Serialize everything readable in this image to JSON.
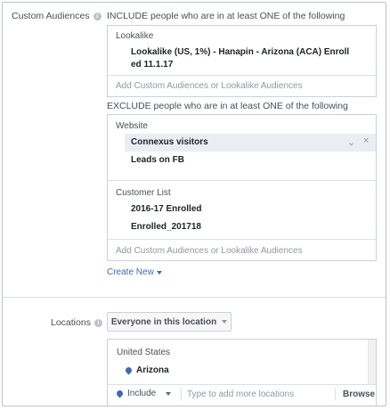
{
  "audiences": {
    "label": "Custom Audiences",
    "include_title": "INCLUDE people who are in at least ONE of the following",
    "include_group_label": "Lookalike",
    "include_item_line1": "Lookalike (US, 1%) - Hanapin - Arizona (ACA) Enroll",
    "include_item_line2": "ed 11.1.17",
    "include_placeholder": "Add Custom Audiences or Lookalike Audiences",
    "exclude_title": "EXCLUDE people who are in at least ONE of the following",
    "exclude_groups": [
      {
        "label": "Website",
        "items": [
          "Connexus visitors",
          "Leads on FB"
        ]
      },
      {
        "label": "Customer List",
        "items": [
          "2016-17 Enrolled",
          "Enrolled_201718"
        ]
      }
    ],
    "exclude_placeholder": "Add Custom Audiences or Lookalike Audiences",
    "create_new": "Create New"
  },
  "locations": {
    "label": "Locations",
    "dropdown_value": "Everyone in this location",
    "country": "United States",
    "selected": "Arizona",
    "mode": "Include",
    "input_placeholder": "Type to add more locations",
    "browse": "Browse"
  },
  "icons": {
    "info": "info-icon",
    "chevron": "chevron-down-icon",
    "remove": "close-icon",
    "pin": "location-pin-icon"
  }
}
